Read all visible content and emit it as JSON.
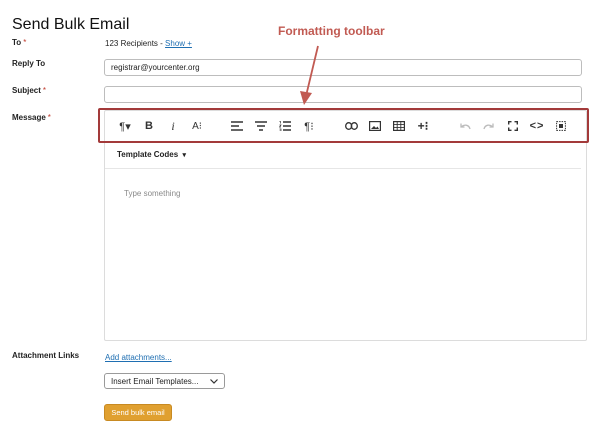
{
  "page": {
    "title": "Send Bulk Email"
  },
  "form": {
    "to": {
      "label": "To",
      "required_mark": "*",
      "recipients_text": "123 Recipients -",
      "show_link": "Show +"
    },
    "reply_to": {
      "label": "Reply To",
      "value": "registrar@yourcenter.org"
    },
    "subject": {
      "label": "Subject",
      "required_mark": "*",
      "value": ""
    },
    "message": {
      "label": "Message",
      "required_mark": "*"
    },
    "attachments": {
      "label": "Attachment Links",
      "link": "Add attachments..."
    }
  },
  "editor": {
    "template_codes_label": "Template Codes",
    "placeholder": "Type something",
    "toolbar": [
      {
        "name": "paragraph-format",
        "icon": "pilcrow-dropdown-icon",
        "glyph": "¶▾"
      },
      {
        "name": "bold",
        "icon": "bold-icon",
        "glyph": "B"
      },
      {
        "name": "italic",
        "icon": "italic-icon",
        "glyph": "i"
      },
      {
        "name": "font-size",
        "icon": "font-size-icon",
        "glyph": "A⁝"
      },
      {
        "name": "align",
        "icon": "align-left-icon",
        "glyph": ""
      },
      {
        "name": "align-center",
        "icon": "align-center-icon",
        "glyph": ""
      },
      {
        "name": "ordered-list",
        "icon": "ordered-list-icon",
        "glyph": ""
      },
      {
        "name": "paragraph-more",
        "icon": "pilcrow-more-icon",
        "glyph": "¶⁝"
      },
      {
        "name": "link",
        "icon": "link-icon",
        "glyph": ""
      },
      {
        "name": "image",
        "icon": "image-icon",
        "glyph": ""
      },
      {
        "name": "table",
        "icon": "table-icon",
        "glyph": ""
      },
      {
        "name": "insert-more",
        "icon": "plus-more-icon",
        "glyph": "+⁝"
      },
      {
        "name": "undo",
        "icon": "undo-icon",
        "glyph": ""
      },
      {
        "name": "redo",
        "icon": "redo-icon",
        "glyph": ""
      },
      {
        "name": "fullscreen",
        "icon": "fullscreen-icon",
        "glyph": ""
      },
      {
        "name": "code-view",
        "icon": "code-icon",
        "glyph": "<>"
      },
      {
        "name": "select-all",
        "icon": "select-all-icon",
        "glyph": ""
      }
    ]
  },
  "templates_select": {
    "selected": "Insert Email Templates..."
  },
  "send_button": {
    "label": "Send bulk email"
  },
  "annotation": {
    "text": "Formatting toolbar"
  },
  "colors": {
    "accent_button": "#e0a030",
    "annotation": "#c15a52",
    "link": "#1f6fb2",
    "required": "#c0392b"
  }
}
